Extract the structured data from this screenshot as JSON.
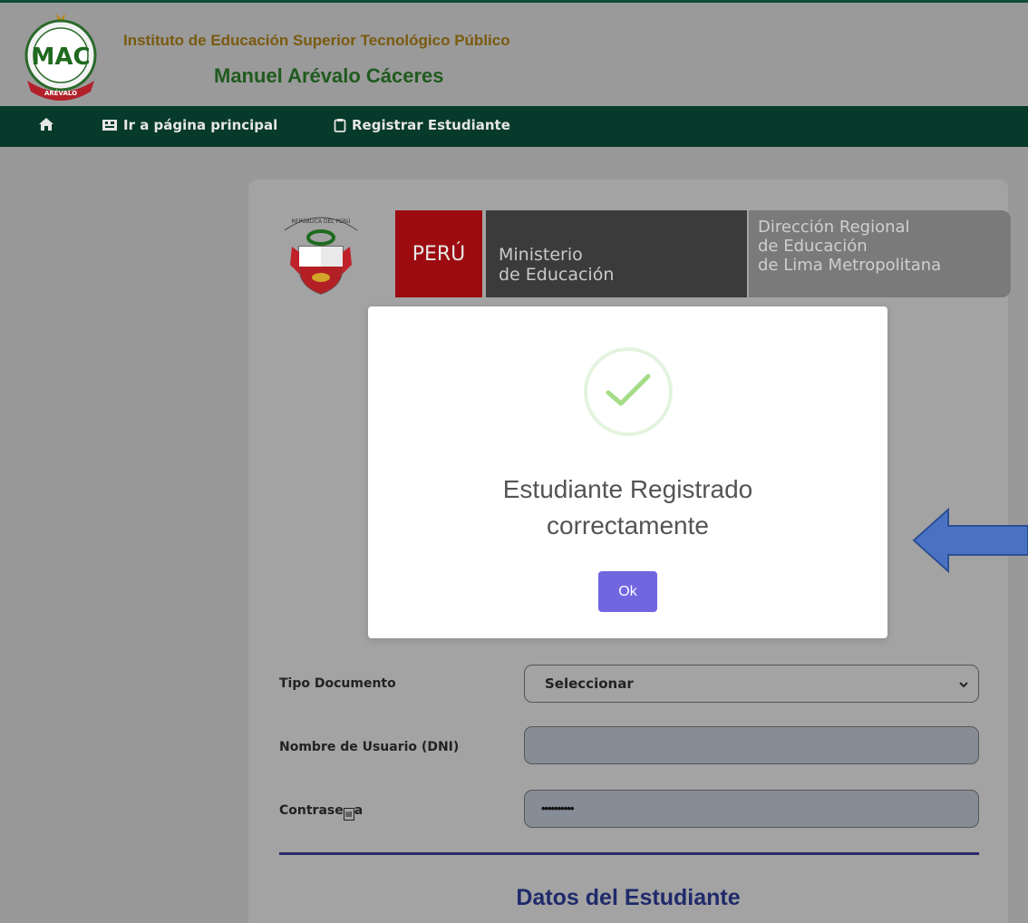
{
  "header": {
    "institute_line1": "Instituto de Educación Superior Tecnológico Público",
    "institute_line2": "Manuel Arévalo Cáceres",
    "logo_text": "MAC",
    "logo_ribbon": "MANUEL ARÉVALO CÁCERES"
  },
  "nav": {
    "home_icon": "home-icon",
    "main_page_label": "Ir a página principal",
    "register_label": "Registrar Estudiante"
  },
  "banner": {
    "shield_caption": "REPÚBLICA DEL PERÚ",
    "peru": "PERÚ",
    "ministry_line1": "Ministerio",
    "ministry_line2": "de Educación",
    "drelm_line1": "Dirección Regional",
    "drelm_line2": "de Educación",
    "drelm_line3": "de Lima Metropolitana"
  },
  "form": {
    "doc_type_label": "Tipo Documento",
    "doc_type_value": "Seleccionar",
    "username_label": "Nombre de Usuario (DNI)",
    "username_value": "",
    "password_label": "Contrase\u0000a",
    "password_value": "••••••••••",
    "section_title": "Datos del Estudiante"
  },
  "modal": {
    "title_line1": "Estudiante Registrado",
    "title_line2": "correctamente",
    "ok_label": "Ok",
    "icon": "success-check-icon"
  },
  "colors": {
    "nav_bg": "#063a2a",
    "peru_red": "#9b0b10",
    "ok_button": "#7066e0",
    "arrow": "#4a72c4",
    "section_title": "#1f2a6b"
  }
}
